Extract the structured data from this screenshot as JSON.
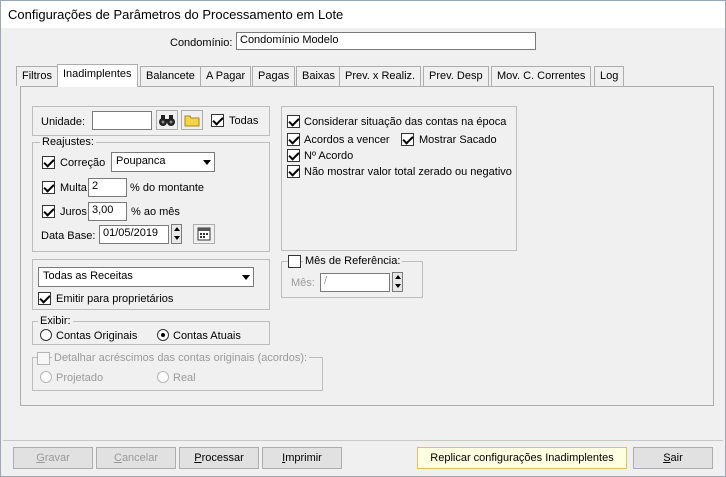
{
  "window": {
    "title": "Configurações de Parâmetros do Processamento em Lote"
  },
  "condominio": {
    "label": "Condomínio:",
    "value": "Condomínio Modelo"
  },
  "tabs": [
    {
      "label": "Filtros"
    },
    {
      "label": "Inadimplentes"
    },
    {
      "label": "Balancete"
    },
    {
      "label": "A Pagar"
    },
    {
      "label": "Pagas"
    },
    {
      "label": "Baixas"
    },
    {
      "label": "Prev. x Realiz."
    },
    {
      "label": "Prev. Desp"
    },
    {
      "label": "Mov. C. Correntes"
    },
    {
      "label": "Log"
    }
  ],
  "unidade": {
    "label": "Unidade:",
    "value": "",
    "todas_label": "Todas",
    "todas_checked": true
  },
  "reajustes": {
    "legend": "Reajustes:",
    "correcao_label": "Correção",
    "correcao_value": "Poupanca",
    "multa_label": "Multa",
    "multa_value": "2",
    "multa_suffix": "% do montante",
    "juros_label": "Juros",
    "juros_value": "3,00",
    "juros_suffix": "% ao mês",
    "database_label": "Data Base:",
    "database_value": "01/05/2019"
  },
  "receitas": {
    "value": "Todas as Receitas",
    "emitir_label": "Emitir para proprietários"
  },
  "exibir": {
    "legend": "Exibir:",
    "originais_label": "Contas Originais",
    "atuais_label": "Contas Atuais"
  },
  "detalhar": {
    "legend": "Detalhar acréscimos das contas originais (acordos):",
    "projetado_label": "Projetado",
    "real_label": "Real"
  },
  "options": {
    "considerar_label": "Considerar situação das contas na época",
    "acordos_label": "Acordos a vencer",
    "sacado_label": "Mostrar Sacado",
    "nacordo_label": "Nº Acordo",
    "naomostrar_label": "Não mostrar valor total zerado ou negativo"
  },
  "mesref": {
    "legend": "Mês de Referência:",
    "mes_label": "Mês:",
    "mes_value": " /"
  },
  "buttons": {
    "gravar_ul": "G",
    "gravar_rest": "ravar",
    "cancelar_ul": "C",
    "cancelar_rest": "ancelar",
    "processar_ul": "P",
    "processar_rest": "rocessar",
    "imprimir_ul": "I",
    "imprimir_rest": "mprimir",
    "replicar": "Replicar configurações Inadimplentes",
    "sair_ul": "S",
    "sair_rest": "air"
  },
  "colors": {
    "replicar_bg": "#ffffe1",
    "replicar_border": "#e0c060"
  }
}
